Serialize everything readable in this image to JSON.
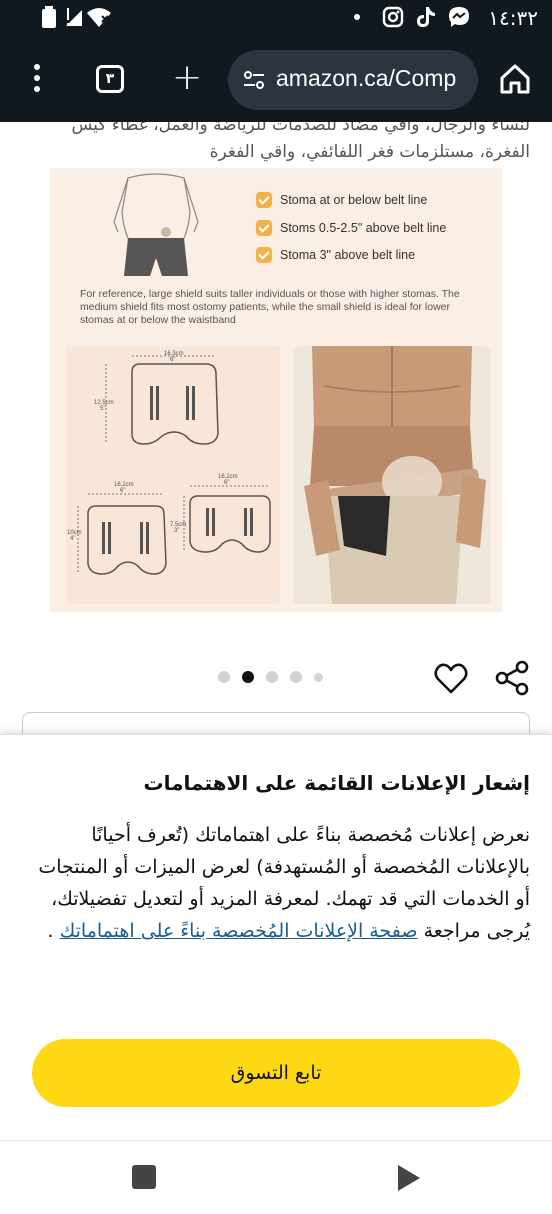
{
  "status_bar": {
    "time": "١٤:٣٢"
  },
  "browser": {
    "tab_count": "٣",
    "url": "amazon.ca/Comp"
  },
  "product": {
    "title_line1": "لنساء والرجال، واقي مضاد للصدمات للرياضة والعمل، غطاء كيس",
    "title_line2": "الفغرة، مستلزمات فغر اللفائفي، واقي الفغرة",
    "image": {
      "options": [
        "Stoma at or below belt line",
        "Stoms 0.5-2.5\" above belt line",
        "Stoma 3\" above belt line"
      ],
      "reference_text": "For reference, large shield suits taller individuals or those with higher stomas. The medium shield fits most ostomy patients, while the small shield is ideal for lower stomas at or below the waistband",
      "dims": {
        "large_w": "16.3cm",
        "large_w_in": "6\"",
        "large_h": "12.5cm",
        "large_h_in": "5\"",
        "med_w": "16.2cm",
        "med_w_in": "6\"",
        "med_h": "10cm",
        "med_h_in": "4\"",
        "small_w": "16.2cm",
        "small_w_in": "6\"",
        "small_h": "7.5cm",
        "small_h_in": "3\""
      }
    },
    "carousel": {
      "count": 5,
      "active_index": 1
    }
  },
  "consent_sheet": {
    "title": "إشعار الإعلانات القائمة على الاهتمامات",
    "body": "نعرض إعلانات مُخصصة بناءً على اهتماماتك (تُعرف أحيانًا بالإعلانات المُخصصة أو المُستهدفة) لعرض الميزات أو المنتجات أو الخدمات التي قد تهمك. لمعرفة المزيد أو لتعديل تفضيلاتك، يُرجى مراجعة",
    "link": "صفحة الإعلانات المُخصصة بناءً على اهتماماتك",
    "after_link": " .",
    "button": "تابع التسوق"
  }
}
